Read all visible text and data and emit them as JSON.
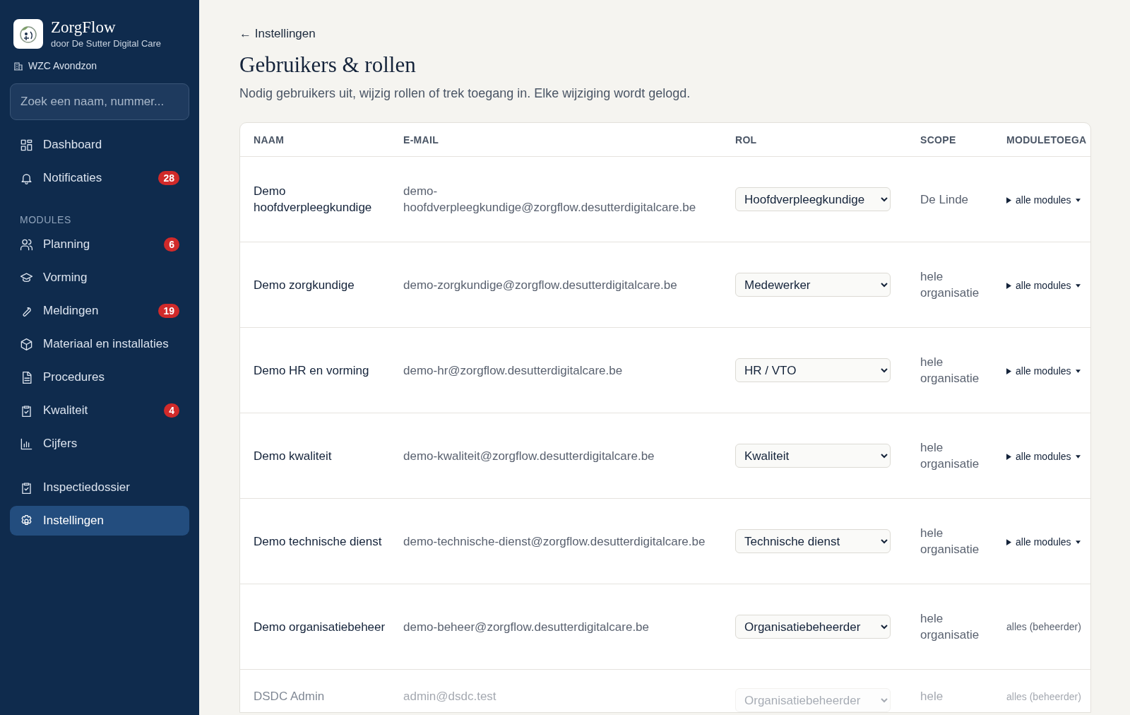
{
  "sidebar": {
    "brand": {
      "name": "ZorgFlow",
      "tagline": "door De Sutter Digital Care"
    },
    "facility": "WZC Avondzon",
    "search": {
      "placeholder": "Zoek een naam, nummer..."
    },
    "groups": [
      {
        "items": [
          {
            "label": "Dashboard",
            "selected": false
          },
          {
            "label": "Notificaties",
            "badge": "28",
            "selected": false
          }
        ]
      },
      {
        "heading": "MODULES",
        "items": [
          {
            "label": "Planning",
            "badge": "6",
            "selected": false
          },
          {
            "label": "Vorming",
            "selected": false
          },
          {
            "label": "Meldingen",
            "badge": "19",
            "selected": false
          },
          {
            "label": "Materiaal en installaties",
            "selected": false
          },
          {
            "label": "Procedures",
            "selected": false
          },
          {
            "label": "Kwaliteit",
            "badge": "4",
            "selected": false
          },
          {
            "label": "Cijfers",
            "selected": false
          }
        ]
      },
      {
        "items": [
          {
            "label": "Inspectiedossier",
            "selected": false
          },
          {
            "label": "Instellingen",
            "selected": true
          }
        ]
      }
    ]
  },
  "main": {
    "back_link": "← Instellingen",
    "title": "Gebruikers & rollen",
    "subtitle": "Nodig gebruikers uit, wijzig rollen of trek toegang in. Elke wijziging wordt gelogd.",
    "table": {
      "columns": [
        "NAAM",
        "E-MAIL",
        "ROL",
        "SCOPE",
        "MODULETOEGA"
      ],
      "rows": [
        {
          "name": "Demo hoofdverpleegkundige",
          "email": "demo-hoofdverpleegkundige@zorgflow.desutterdigitalcare.be",
          "role": "Hoofdverpleegkundige",
          "scope": "De Linde",
          "access": {
            "kind": "expander",
            "label": "alle modules"
          },
          "disabled": false
        },
        {
          "name": "Demo zorgkundige",
          "email": "demo-zorgkundige@zorgflow.desutterdigitalcare.be",
          "role": "Medewerker",
          "scope": "hele organisatie",
          "access": {
            "kind": "expander",
            "label": "alle modules"
          },
          "disabled": false
        },
        {
          "name": "Demo HR en vorming",
          "email": "demo-hr@zorgflow.desutterdigitalcare.be",
          "role": "HR / VTO",
          "scope": "hele organisatie",
          "access": {
            "kind": "expander",
            "label": "alle modules"
          },
          "disabled": false
        },
        {
          "name": "Demo kwaliteit",
          "email": "demo-kwaliteit@zorgflow.desutterdigitalcare.be",
          "role": "Kwaliteit",
          "scope": "hele organisatie",
          "access": {
            "kind": "expander",
            "label": "alle modules"
          },
          "disabled": false
        },
        {
          "name": "Demo technische dienst",
          "email": "demo-technische-dienst@zorgflow.desutterdigitalcare.be",
          "role": "Technische dienst",
          "scope": "hele organisatie",
          "access": {
            "kind": "expander",
            "label": "alle modules"
          },
          "disabled": false
        },
        {
          "name": "Demo organisatiebeheer",
          "email": "demo-beheer@zorgflow.desutterdigitalcare.be",
          "role": "Organisatiebeheerder",
          "scope": "hele organisatie",
          "access": {
            "kind": "text",
            "label": "alles (beheerder)"
          },
          "disabled": false
        },
        {
          "name": "DSDC Admin",
          "email": "admin@dsdc.test",
          "role": "Organisatiebeheerder",
          "scope": "hele",
          "access": {
            "kind": "text",
            "label": "alles (beheerder)"
          },
          "disabled": true
        }
      ]
    }
  }
}
